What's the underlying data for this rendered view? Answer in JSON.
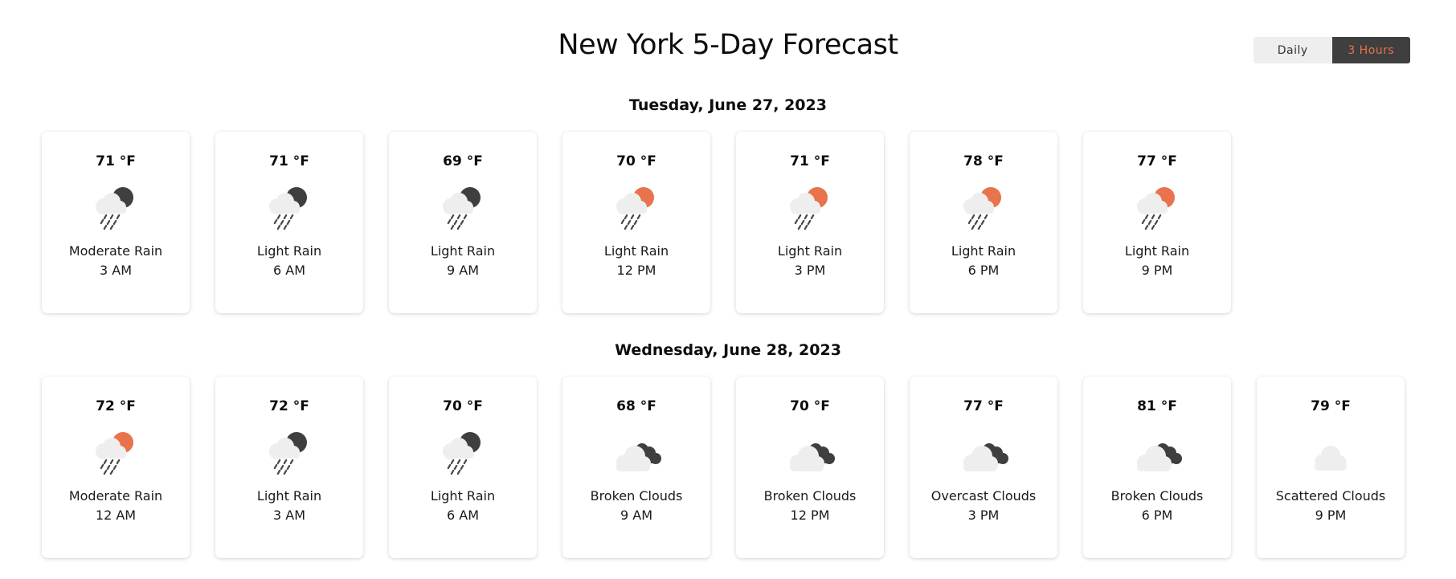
{
  "page": {
    "title": "New York 5-Day Forecast"
  },
  "toggle": {
    "daily_label": "Daily",
    "hours_label": "3 Hours",
    "active": "3 Hours"
  },
  "colors": {
    "accent": "#e8734c",
    "dark": "#3f3f3f",
    "cloud": "#eeeeee"
  },
  "days": [
    {
      "heading": "Tuesday, June 27, 2023",
      "forecasts": [
        {
          "temp": "71 °F",
          "desc": "Moderate Rain",
          "time": "3 AM",
          "icon": "rain-night-icon"
        },
        {
          "temp": "71 °F",
          "desc": "Light Rain",
          "time": "6 AM",
          "icon": "rain-night-icon"
        },
        {
          "temp": "69 °F",
          "desc": "Light Rain",
          "time": "9 AM",
          "icon": "rain-night-icon"
        },
        {
          "temp": "70 °F",
          "desc": "Light Rain",
          "time": "12 PM",
          "icon": "rain-day-icon"
        },
        {
          "temp": "71 °F",
          "desc": "Light Rain",
          "time": "3 PM",
          "icon": "rain-day-icon"
        },
        {
          "temp": "78 °F",
          "desc": "Light Rain",
          "time": "6 PM",
          "icon": "rain-day-icon"
        },
        {
          "temp": "77 °F",
          "desc": "Light Rain",
          "time": "9 PM",
          "icon": "rain-day-icon"
        }
      ]
    },
    {
      "heading": "Wednesday, June 28, 2023",
      "forecasts": [
        {
          "temp": "72 °F",
          "desc": "Moderate Rain",
          "time": "12 AM",
          "icon": "rain-day-icon"
        },
        {
          "temp": "72 °F",
          "desc": "Light Rain",
          "time": "3 AM",
          "icon": "rain-night-icon"
        },
        {
          "temp": "70 °F",
          "desc": "Light Rain",
          "time": "6 AM",
          "icon": "rain-night-icon"
        },
        {
          "temp": "68 °F",
          "desc": "Broken Clouds",
          "time": "9 AM",
          "icon": "broken-clouds-icon"
        },
        {
          "temp": "70 °F",
          "desc": "Broken Clouds",
          "time": "12 PM",
          "icon": "broken-clouds-icon"
        },
        {
          "temp": "77 °F",
          "desc": "Overcast Clouds",
          "time": "3 PM",
          "icon": "broken-clouds-icon"
        },
        {
          "temp": "81 °F",
          "desc": "Broken Clouds",
          "time": "6 PM",
          "icon": "broken-clouds-icon"
        },
        {
          "temp": "79 °F",
          "desc": "Scattered Clouds",
          "time": "9 PM",
          "icon": "scattered-clouds-icon"
        }
      ]
    }
  ]
}
